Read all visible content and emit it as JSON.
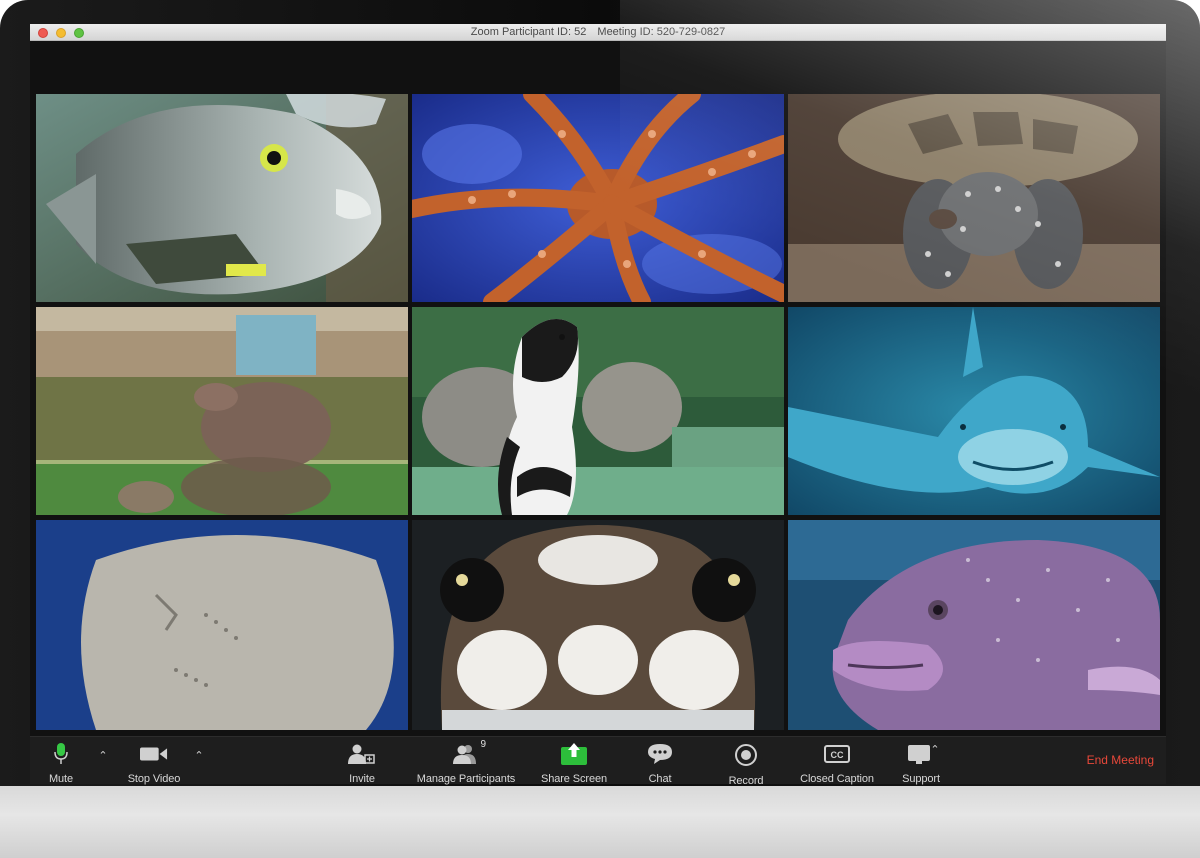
{
  "window": {
    "participant_id": "Zoom Participant ID: 52",
    "meeting_id": "Meeting ID: 520-729-0827"
  },
  "participants": [
    {
      "icon": "angelfish"
    },
    {
      "icon": "octopus"
    },
    {
      "icon": "turtle"
    },
    {
      "icon": "hippopotamus"
    },
    {
      "icon": "penguin"
    },
    {
      "icon": "shark"
    },
    {
      "icon": "stingray"
    },
    {
      "icon": "frog"
    },
    {
      "icon": "grouper-fish"
    }
  ],
  "toolbar": {
    "mute": "Mute",
    "stop_video": "Stop Video",
    "invite": "Invite",
    "manage_participants": "Manage Participants",
    "participant_count": "9",
    "share_screen": "Share Screen",
    "chat": "Chat",
    "record": "Record",
    "closed_caption": "Closed Caption",
    "support": "Support",
    "end_meeting": "End Meeting"
  },
  "colors": {
    "end_meeting": "#e8483a",
    "share_screen": "#2dbe3b",
    "toolbar_bg": "#1e1e1e"
  }
}
